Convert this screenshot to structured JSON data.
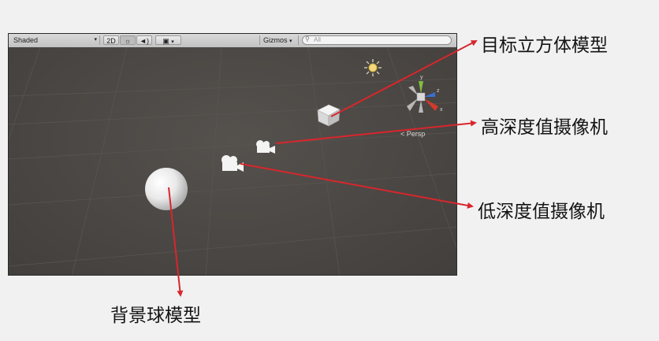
{
  "toolbar": {
    "shading_mode": "Shaded",
    "mode_2d": "2D",
    "gizmos": "Gizmos",
    "search_placeholder": "All"
  },
  "scene": {
    "view_label": "< Persp",
    "axis_labels": {
      "y": "y",
      "z": "z",
      "x": "x"
    }
  },
  "annotations": {
    "target_cube": "目标立方体模型",
    "high_depth_camera": "高深度值摄像机",
    "low_depth_camera": "低深度值摄像机",
    "background_sphere": "背景球模型"
  },
  "colors": {
    "arrow": "#d8262c",
    "viewport_bg": "#4a4744"
  }
}
